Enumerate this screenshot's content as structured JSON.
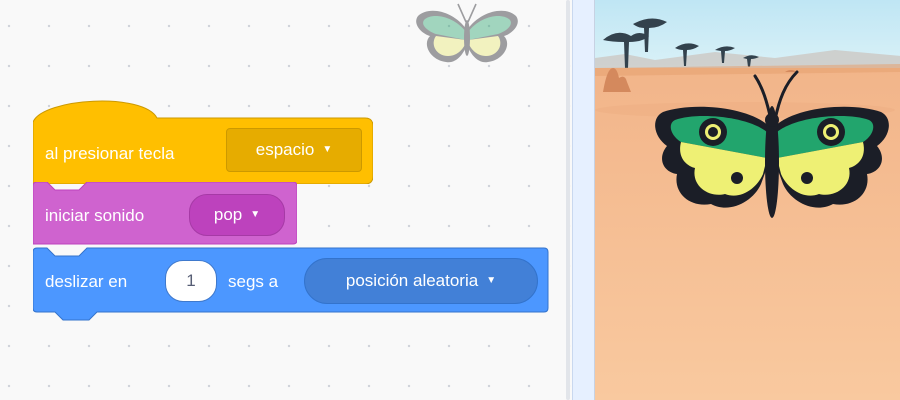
{
  "workspace": {
    "sprite_thumbnail_icon": "butterfly-icon",
    "blocks": {
      "event": {
        "label": "al presionar tecla",
        "key_option": "espacio",
        "color": "#ffbf00",
        "menu_color": "#e6ac00"
      },
      "sound": {
        "label": "iniciar sonido",
        "sound_option": "pop",
        "color": "#cf63cf",
        "menu_color": "#bd42bd"
      },
      "motion": {
        "label_before": "deslizar en",
        "seconds_value": "1",
        "label_after": "segs a",
        "target_option": "posición aleatoria",
        "color": "#4c97ff",
        "menu_color": "#4280d7"
      }
    }
  },
  "stage": {
    "backdrop": "savanna",
    "sprite_icon": "butterfly-icon"
  }
}
